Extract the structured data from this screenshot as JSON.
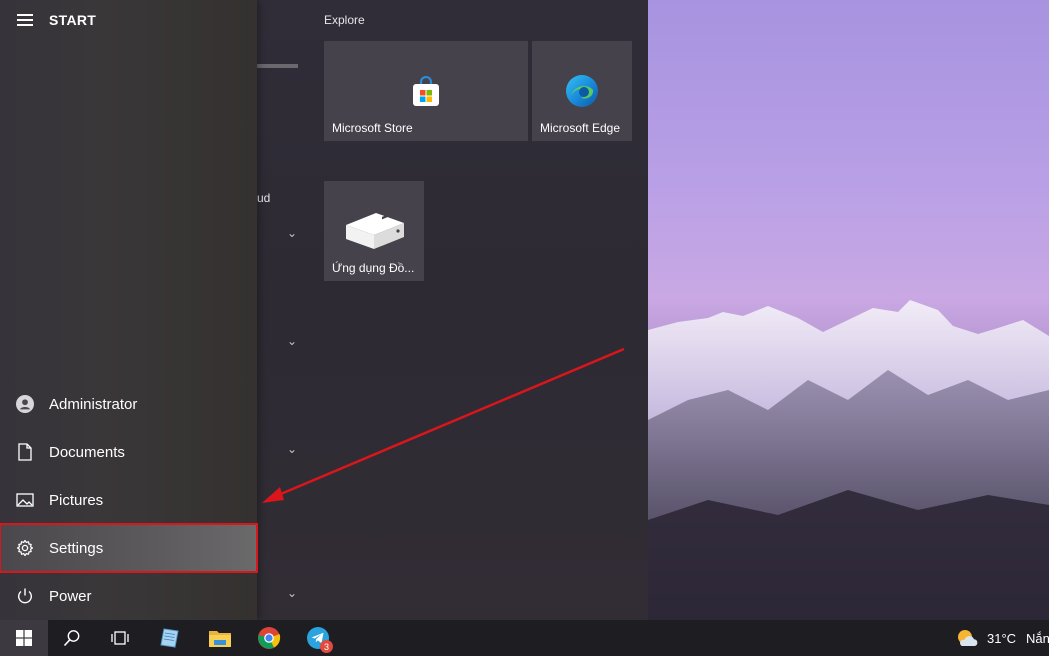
{
  "start_menu": {
    "title": "START",
    "explore_group_label": "Explore",
    "tiles": [
      {
        "label": "Microsoft Store",
        "icon": "store-icon"
      },
      {
        "label": "Microsoft Edge",
        "icon": "edge-icon"
      },
      {
        "label": "Ứng dụng Đồ...",
        "icon": "computer-box-icon"
      }
    ],
    "hidden_list_fragment": "ud",
    "pane_items": [
      {
        "label": "Administrator",
        "icon": "user-icon"
      },
      {
        "label": "Documents",
        "icon": "document-icon"
      },
      {
        "label": "Pictures",
        "icon": "pictures-icon"
      },
      {
        "label": "Settings",
        "icon": "gear-icon",
        "selected": true
      },
      {
        "label": "Power",
        "icon": "power-icon"
      }
    ]
  },
  "taskbar": {
    "items": [
      "windows-start-icon",
      "search-icon",
      "task-view-icon",
      "notepad-icon",
      "file-explorer-icon",
      "chrome-icon",
      "telegram-icon"
    ],
    "telegram_badge": "3",
    "weather_temp": "31°C",
    "weather_text": "Nắn"
  },
  "colors": {
    "highlight_border": "#d9161c",
    "annotation_arrow": "#d9161c",
    "tile_bg": "#45424b"
  }
}
